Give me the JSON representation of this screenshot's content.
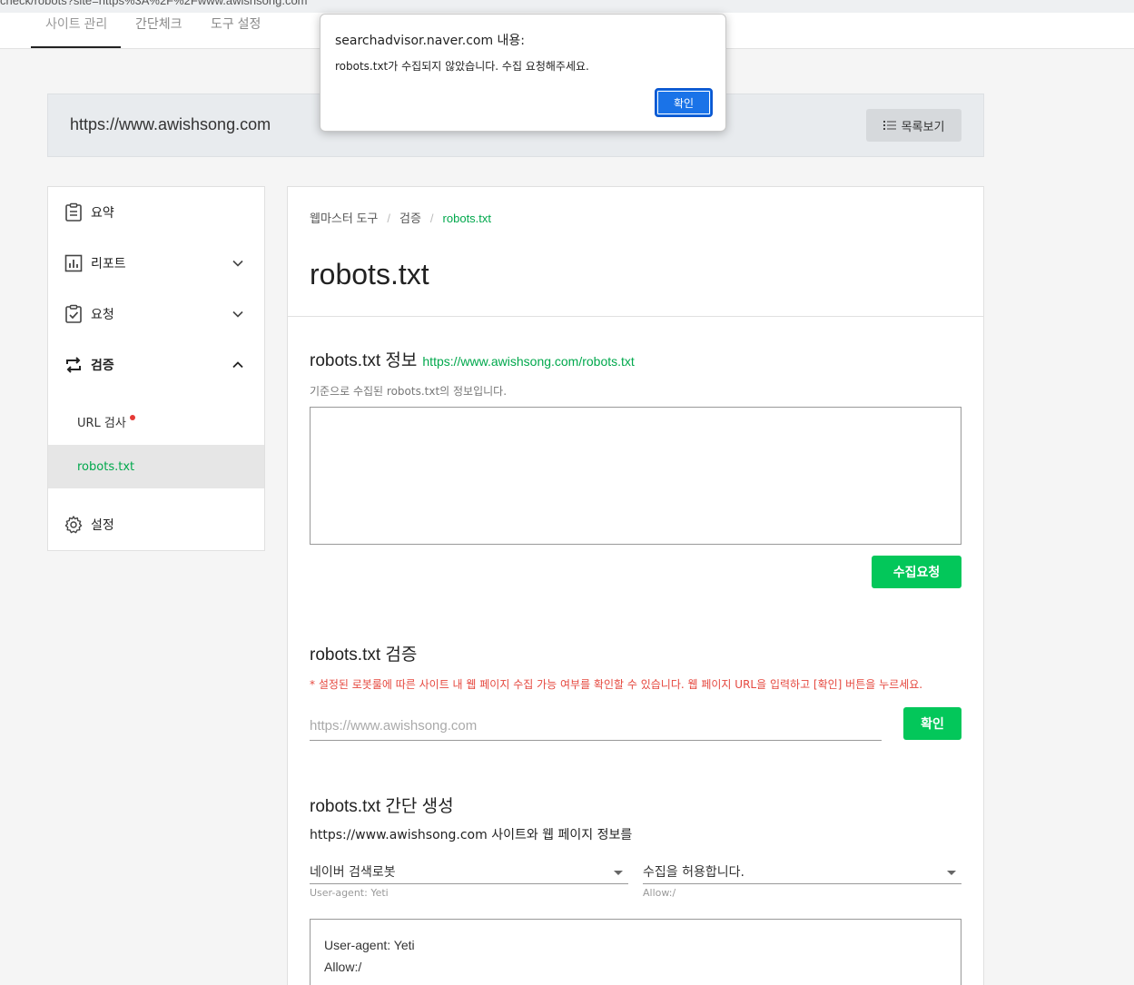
{
  "browser": {
    "address": "check/robots?site=https%3A%2F%2Fwww.awishsong.com"
  },
  "topnav": {
    "tabs": [
      "사이트 관리",
      "간단체크",
      "도구 설정"
    ]
  },
  "site_bar": {
    "url": "https://www.awishsong.com",
    "list_button": "목록보기"
  },
  "sidebar": {
    "items": [
      {
        "label": "요약",
        "icon": "clipboard-icon"
      },
      {
        "label": "리포트",
        "icon": "chart-icon"
      },
      {
        "label": "요청",
        "icon": "checklist-icon"
      },
      {
        "label": "검증",
        "icon": "repeat-icon"
      },
      {
        "label": "설정",
        "icon": "gear-icon"
      }
    ],
    "sub_items": [
      {
        "label": "URL 검사"
      },
      {
        "label": "robots.txt"
      }
    ]
  },
  "main": {
    "breadcrumb": [
      "웹마스터 도구",
      "검증",
      "robots.txt"
    ],
    "title": "robots.txt",
    "info": {
      "title": "robots.txt 정보",
      "link": "https://www.awishsong.com/robots.txt",
      "desc": "기준으로 수집된 robots.txt의 정보입니다.",
      "button": "수집요청"
    },
    "verify": {
      "title": "robots.txt 검증",
      "warning": "* 설정된 로봇룰에 따른 사이트 내 웹 페이지 수집 가능 여부를 확인할 수 있습니다. 웹 페이지 URL을 입력하고 [확인] 버튼을 누르세요.",
      "placeholder": "https://www.awishsong.com",
      "button": "확인"
    },
    "generate": {
      "title": "robots.txt 간단 생성",
      "line": "https://www.awishsong.com 사이트와 웹 페이지 정보를",
      "robot_select": "네이버 검색로봇",
      "robot_hint": "User-agent: Yeti",
      "allow_select": "수집을 허용합니다.",
      "allow_hint": "Allow:/",
      "output_line1": "User-agent: Yeti",
      "output_line2": "Allow:/"
    }
  },
  "dialog": {
    "title": "searchadvisor.naver.com 내용:",
    "message": "robots.txt가 수집되지 않았습니다. 수집 요청해주세요.",
    "button": "확인"
  },
  "colors": {
    "accent": "#03c75a",
    "link": "#00a84c",
    "warning": "#e5483f",
    "dialog_button": "#1a73e8"
  }
}
